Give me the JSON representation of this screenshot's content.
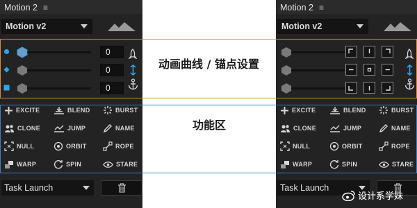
{
  "left_panel": {
    "tab_title": "Motion 2",
    "preset_select": "Motion v2",
    "slider_values": [
      "0",
      "0",
      "0"
    ],
    "functions": [
      {
        "label": "EXCITE",
        "icon": "plus-icon"
      },
      {
        "label": "BLEND",
        "icon": "blend-icon"
      },
      {
        "label": "BURST",
        "icon": "burst-icon"
      },
      {
        "label": "CLONE",
        "icon": "clone-icon"
      },
      {
        "label": "JUMP",
        "icon": "jump-icon"
      },
      {
        "label": "NAME",
        "icon": "pencil-icon"
      },
      {
        "label": "NULL",
        "icon": "null-icon"
      },
      {
        "label": "ORBIT",
        "icon": "orbit-icon"
      },
      {
        "label": "ROPE",
        "icon": "rope-icon"
      },
      {
        "label": "WARP",
        "icon": "warp-icon"
      },
      {
        "label": "SPIN",
        "icon": "spin-icon"
      },
      {
        "label": "STARE",
        "icon": "eye-icon"
      }
    ],
    "task_select": "Task Launch"
  },
  "right_panel": {
    "tab_title": "Motion 2",
    "preset_select": "Motion v2",
    "functions": [
      {
        "label": "EXCITE",
        "icon": "plus-icon"
      },
      {
        "label": "BLEND",
        "icon": "blend-icon"
      },
      {
        "label": "BURST",
        "icon": "burst-icon"
      },
      {
        "label": "CLONE",
        "icon": "clone-icon"
      },
      {
        "label": "JUMP",
        "icon": "jump-icon"
      },
      {
        "label": "NAME",
        "icon": "pencil-icon"
      },
      {
        "label": "NULL",
        "icon": "null-icon"
      },
      {
        "label": "ORBIT",
        "icon": "orbit-icon"
      },
      {
        "label": "ROPE",
        "icon": "rope-icon"
      },
      {
        "label": "WARP",
        "icon": "warp-icon"
      },
      {
        "label": "SPIN",
        "icon": "spin-icon"
      },
      {
        "label": "STARE",
        "icon": "eye-icon"
      }
    ],
    "task_select": "Task Launch"
  },
  "annotations": {
    "anchor_label": "动画曲线 / 锚点设置",
    "function_label": "功能区",
    "orange": "#d9893c",
    "blue": "#3e7fc1"
  },
  "watermark": "设计系学妹",
  "colors": {
    "panel_bg": "#232323",
    "accent_blue": "#2ea3f2"
  }
}
